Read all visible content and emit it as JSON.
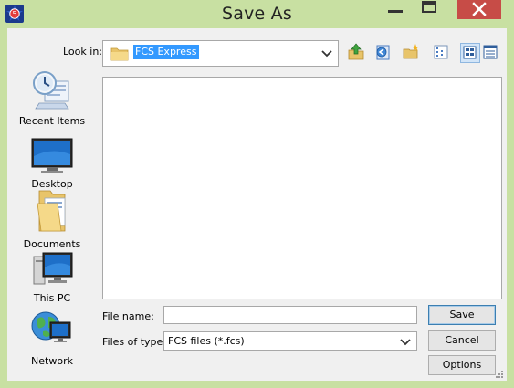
{
  "window": {
    "title": "Save As",
    "app_icon": "fcs-express-app-icon",
    "controls": [
      "minimize-icon",
      "maximize-icon",
      "close-icon"
    ],
    "colors": {
      "frame": "#c8e0a2",
      "close": "#c74c47",
      "selection": "#3399ff"
    }
  },
  "lookin": {
    "label": "Look in:",
    "value": "FCS Express",
    "icon": "folder-icon"
  },
  "toolbar": {
    "buttons": [
      {
        "name": "up-one-level",
        "icon": "up-folder-icon"
      },
      {
        "name": "back",
        "icon": "back-icon"
      },
      {
        "name": "new-folder",
        "icon": "new-folder-icon"
      },
      {
        "name": "list-view",
        "icon": "list-view-icon"
      },
      {
        "name": "details-view",
        "icon": "details-view-icon",
        "pressed": true
      },
      {
        "name": "thumbnails-view",
        "icon": "thumbnails-view-icon"
      }
    ]
  },
  "places": [
    {
      "label": "Recent Items",
      "icon": "recent-items-icon"
    },
    {
      "label": "Desktop",
      "icon": "desktop-icon"
    },
    {
      "label": "Documents",
      "icon": "documents-icon"
    },
    {
      "label": "This PC",
      "icon": "this-pc-icon"
    },
    {
      "label": "Network",
      "icon": "network-icon"
    }
  ],
  "form": {
    "filename_label": "File name:",
    "filename_value": "",
    "filetype_label": "Files of type:",
    "filetype_value": "FCS files (*.fcs)"
  },
  "buttons": {
    "save": "Save",
    "cancel": "Cancel",
    "options": "Options"
  }
}
